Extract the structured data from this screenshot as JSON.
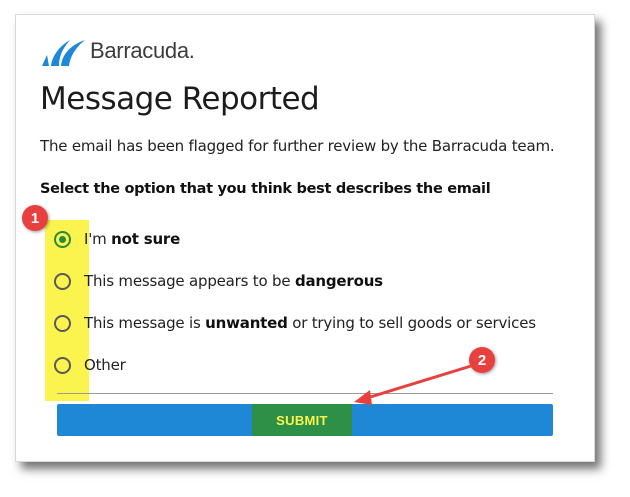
{
  "brand": {
    "name": "Barracuda.",
    "color": "#1e88d6"
  },
  "page": {
    "title": "Message Reported",
    "description": "The email has been flagged for further review by the Barracuda team.",
    "question": "Select the option that you think best describes the email"
  },
  "options": [
    {
      "pre": "I'm ",
      "bold": "not sure",
      "post": "",
      "checked": true
    },
    {
      "pre": "This message appears to be ",
      "bold": "dangerous",
      "post": "",
      "checked": false
    },
    {
      "pre": "This message is ",
      "bold": "unwanted",
      "post": " or trying to sell goods or services",
      "checked": false
    },
    {
      "pre": "Other",
      "bold": "",
      "post": "",
      "checked": false
    }
  ],
  "submit": {
    "label": "SUBMIT"
  },
  "annotations": {
    "badge1": "1",
    "badge2": "2",
    "highlight_color": "#fbf44e",
    "badge_color": "#e8403e"
  }
}
